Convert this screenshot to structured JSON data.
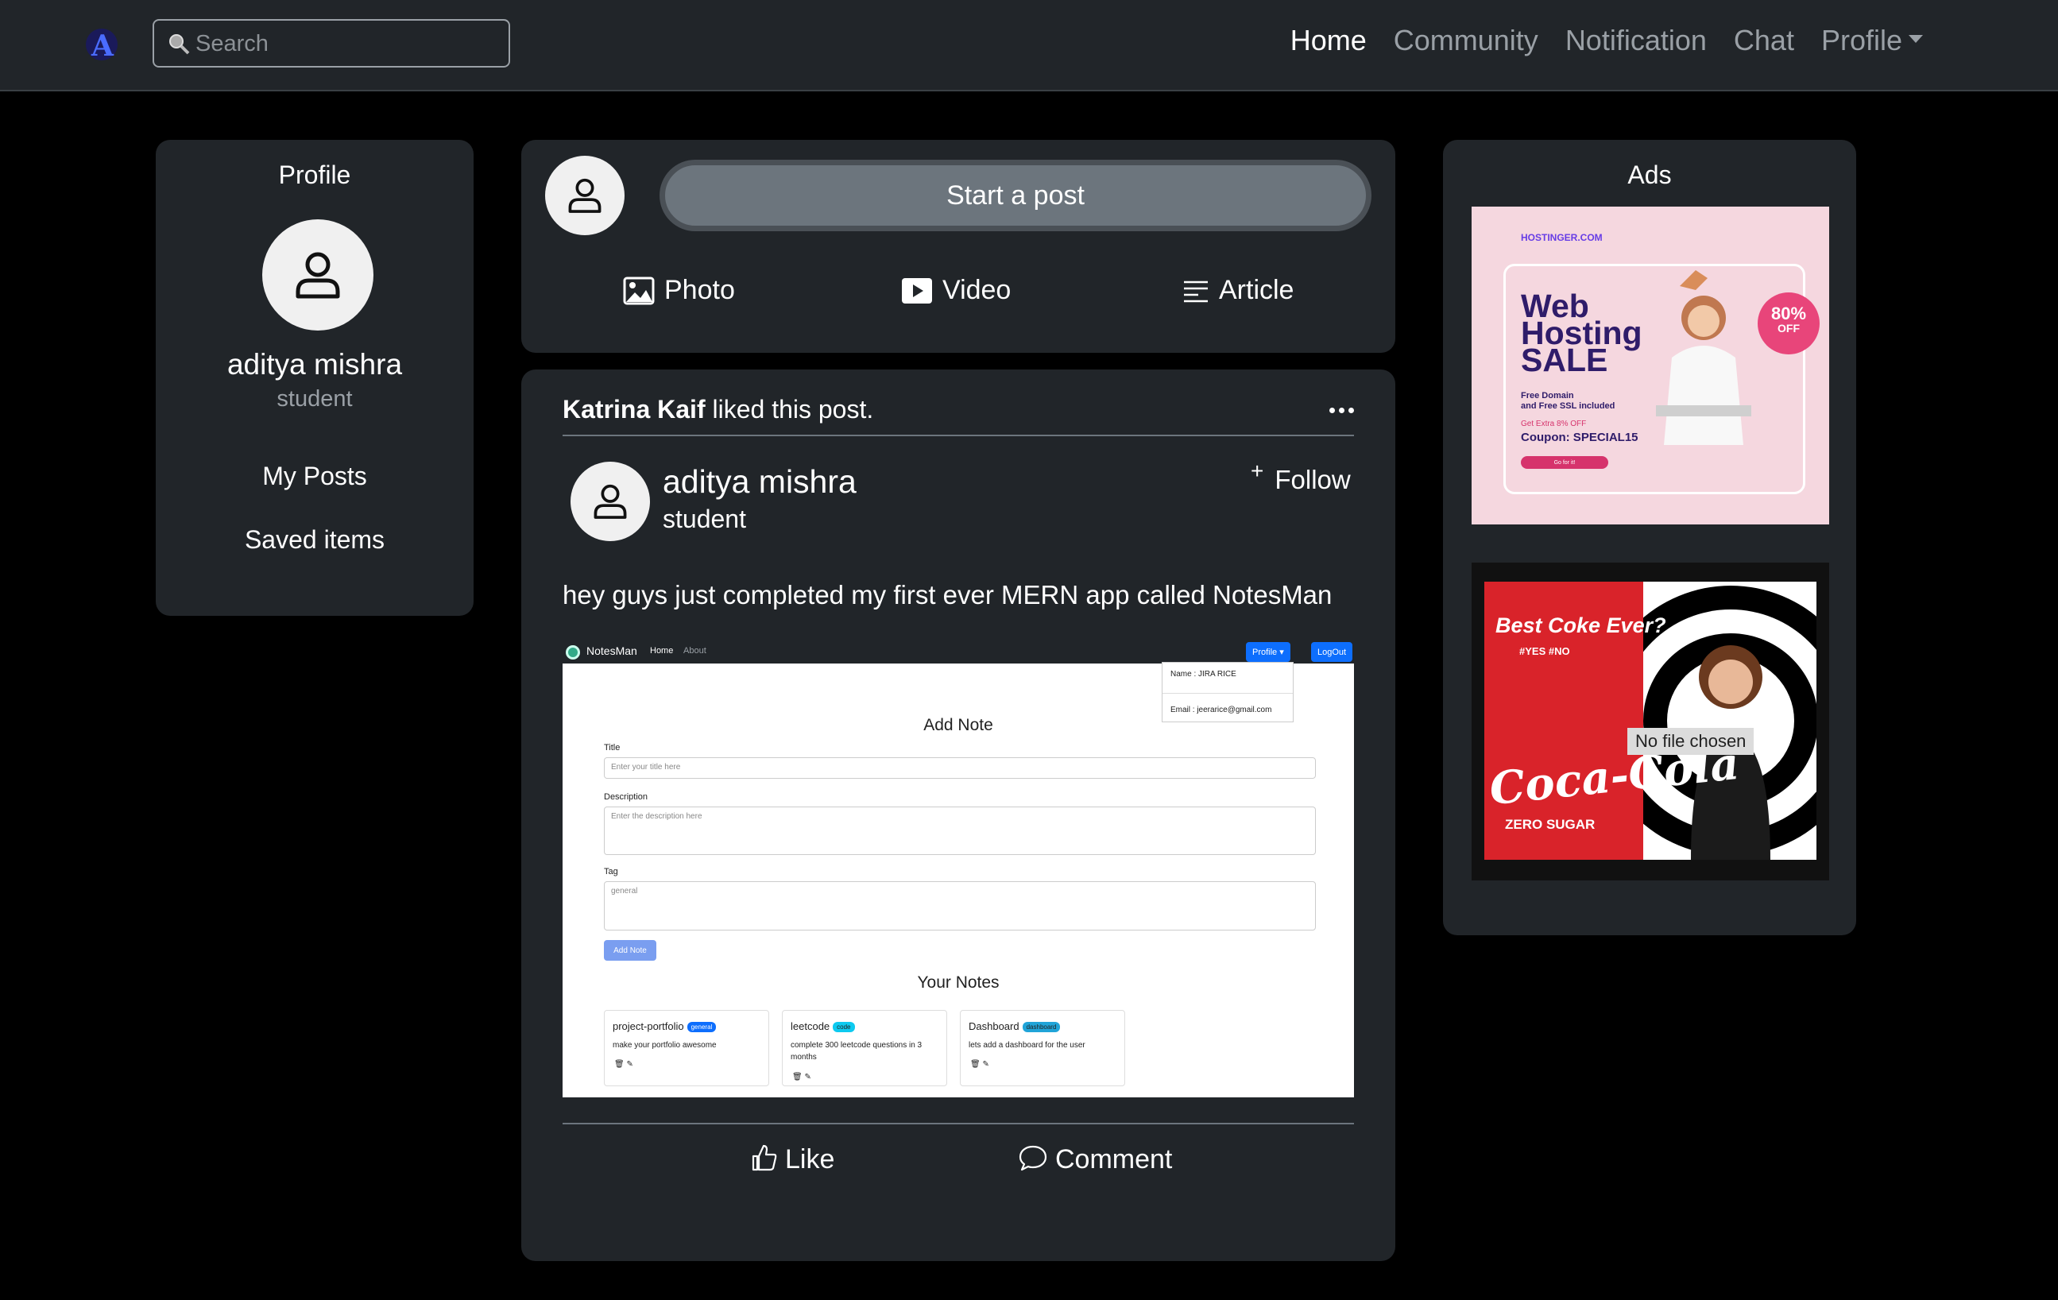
{
  "navbar": {
    "logo_letter": "A",
    "search_placeholder": "Search",
    "links": [
      {
        "label": "Home"
      },
      {
        "label": "Community"
      },
      {
        "label": "Notification"
      },
      {
        "label": "Chat"
      },
      {
        "label": "Profile"
      }
    ]
  },
  "profile": {
    "title": "Profile",
    "name": "aditya mishra",
    "role": "student",
    "links": [
      "My Posts",
      "Saved items"
    ]
  },
  "composer": {
    "start_label": "Start a post",
    "actions": [
      {
        "label": "Photo",
        "icon": "image-icon"
      },
      {
        "label": "Video",
        "icon": "play-icon"
      },
      {
        "label": "Article",
        "icon": "article-icon"
      }
    ]
  },
  "post": {
    "liker": "Katrina Kaif",
    "liked_text": "liked this post.",
    "author": "aditya mishra",
    "role": "student",
    "follow_label": "Follow",
    "text": "hey guys just completed my first ever MERN app called NotesMan",
    "like_label": "Like",
    "comment_label": "Comment",
    "screenshot": {
      "brand": "NotesMan",
      "nav_home": "Home",
      "nav_about": "About",
      "profile_btn": "Profile ▾",
      "logout_btn": "LogOut",
      "dd_name": "Name : JIRA RICE",
      "dd_email": "Email : jeerarice@gmail.com",
      "add_note_heading": "Add Note",
      "title_label": "Title",
      "title_placeholder": "Enter your title here",
      "desc_label": "Description",
      "desc_placeholder": "Enter the description here",
      "tag_label": "Tag",
      "tag_placeholder": "general",
      "add_button": "Add Note",
      "your_notes_heading": "Your Notes",
      "notes": [
        {
          "title": "project-portfolio",
          "tag": "general",
          "tag_color": "#0d6efd",
          "desc": "make your portfolio awesome"
        },
        {
          "title": "leetcode",
          "tag": "code",
          "tag_color": "#0dcaf0",
          "desc": "complete 300 leetcode questions in 3 months"
        },
        {
          "title": "Dashboard",
          "tag": "dashboard",
          "tag_color": "#20a4d8",
          "desc": "lets add a dashboard for the user"
        }
      ]
    }
  },
  "ads": {
    "title": "Ads",
    "hostinger": {
      "brand": "HOSTINGER.COM",
      "headline": [
        "Web",
        "Hosting",
        "SALE"
      ],
      "subline": [
        "Free Domain",
        "and Free SSL included"
      ],
      "extra": "Get Extra 8% OFF",
      "coupon": "Coupon: SPECIAL15",
      "cta": "Go for it!",
      "badge_pct": "80%",
      "badge_off": "OFF"
    },
    "coke": {
      "headline": "Best Coke Ever?",
      "hashtags": "#YES #NO",
      "brand": "Coca-Cola",
      "variant": "ZERO SUGAR",
      "file_status": "No file chosen"
    }
  },
  "colors": {
    "background": "#000000",
    "card": "#212529",
    "muted": "#9aa0a6",
    "start_post": "#6c757d"
  }
}
